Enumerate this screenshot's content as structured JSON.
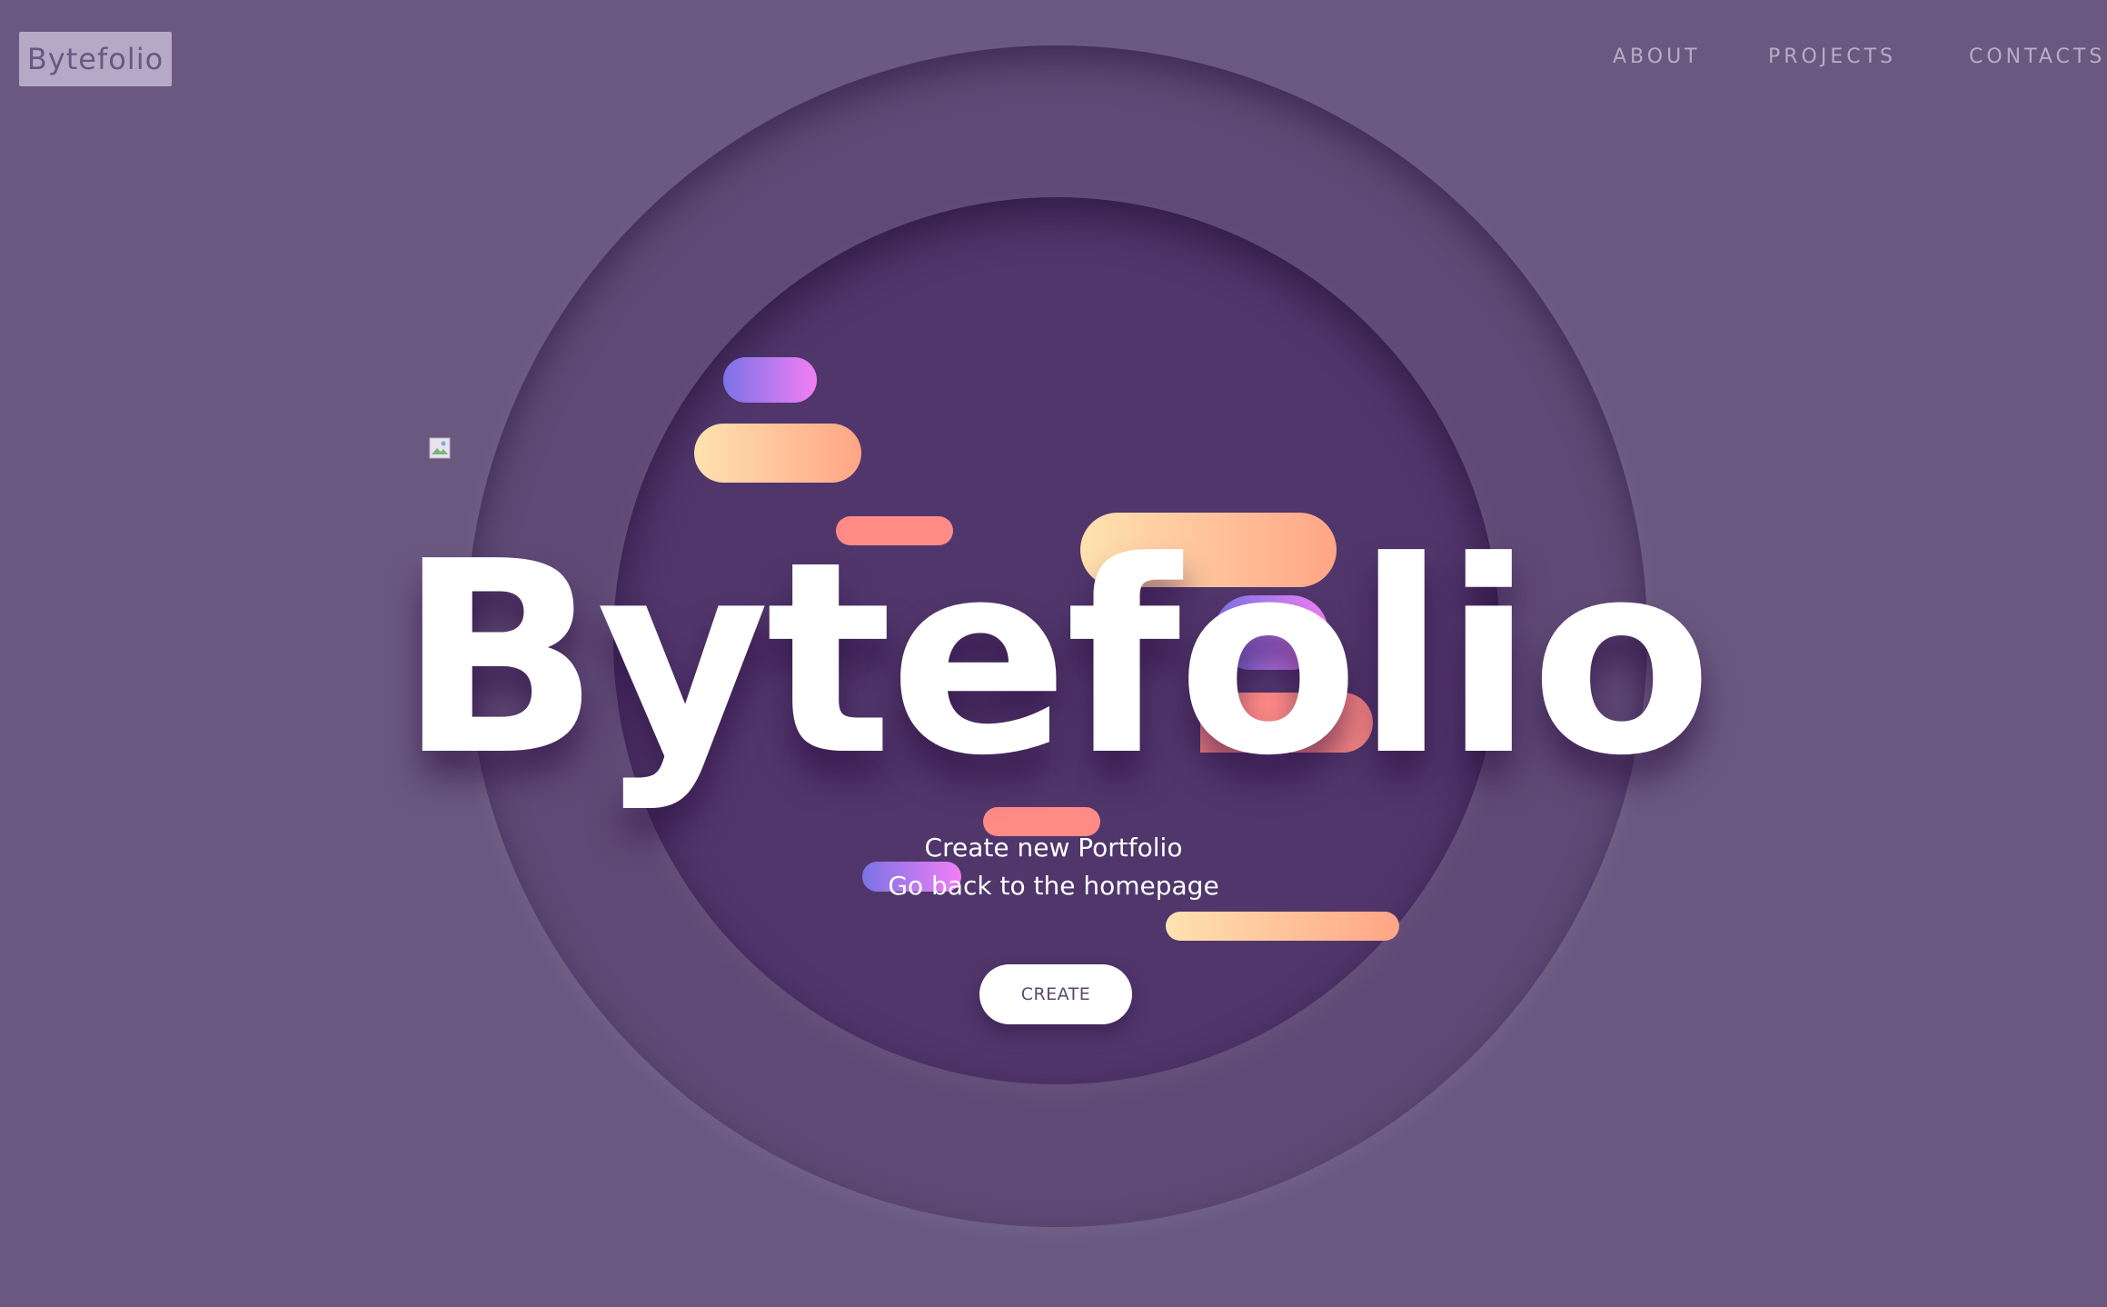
{
  "header": {
    "logo": "Bytefolio",
    "nav": [
      {
        "label": "ABOUT"
      },
      {
        "label": "PROJECTS"
      },
      {
        "label": "CONTACTS"
      }
    ]
  },
  "hero": {
    "title": "Bytefolio",
    "links": [
      {
        "label": "Create new Portfolio"
      },
      {
        "label": "Go back to the homepage"
      }
    ],
    "button": "CREATE"
  },
  "colors": {
    "background": "#6a5880",
    "outer_ring": "#5f4976",
    "inner_ring": "#50366b",
    "accent_purple_start": "#7a73e6",
    "accent_purple_end": "#f27ef5",
    "accent_peach_start": "#ffe2b0",
    "accent_peach_end": "#ffa586",
    "accent_coral": "#ff8b86"
  },
  "icons": {
    "broken_image": "broken-image-icon"
  }
}
